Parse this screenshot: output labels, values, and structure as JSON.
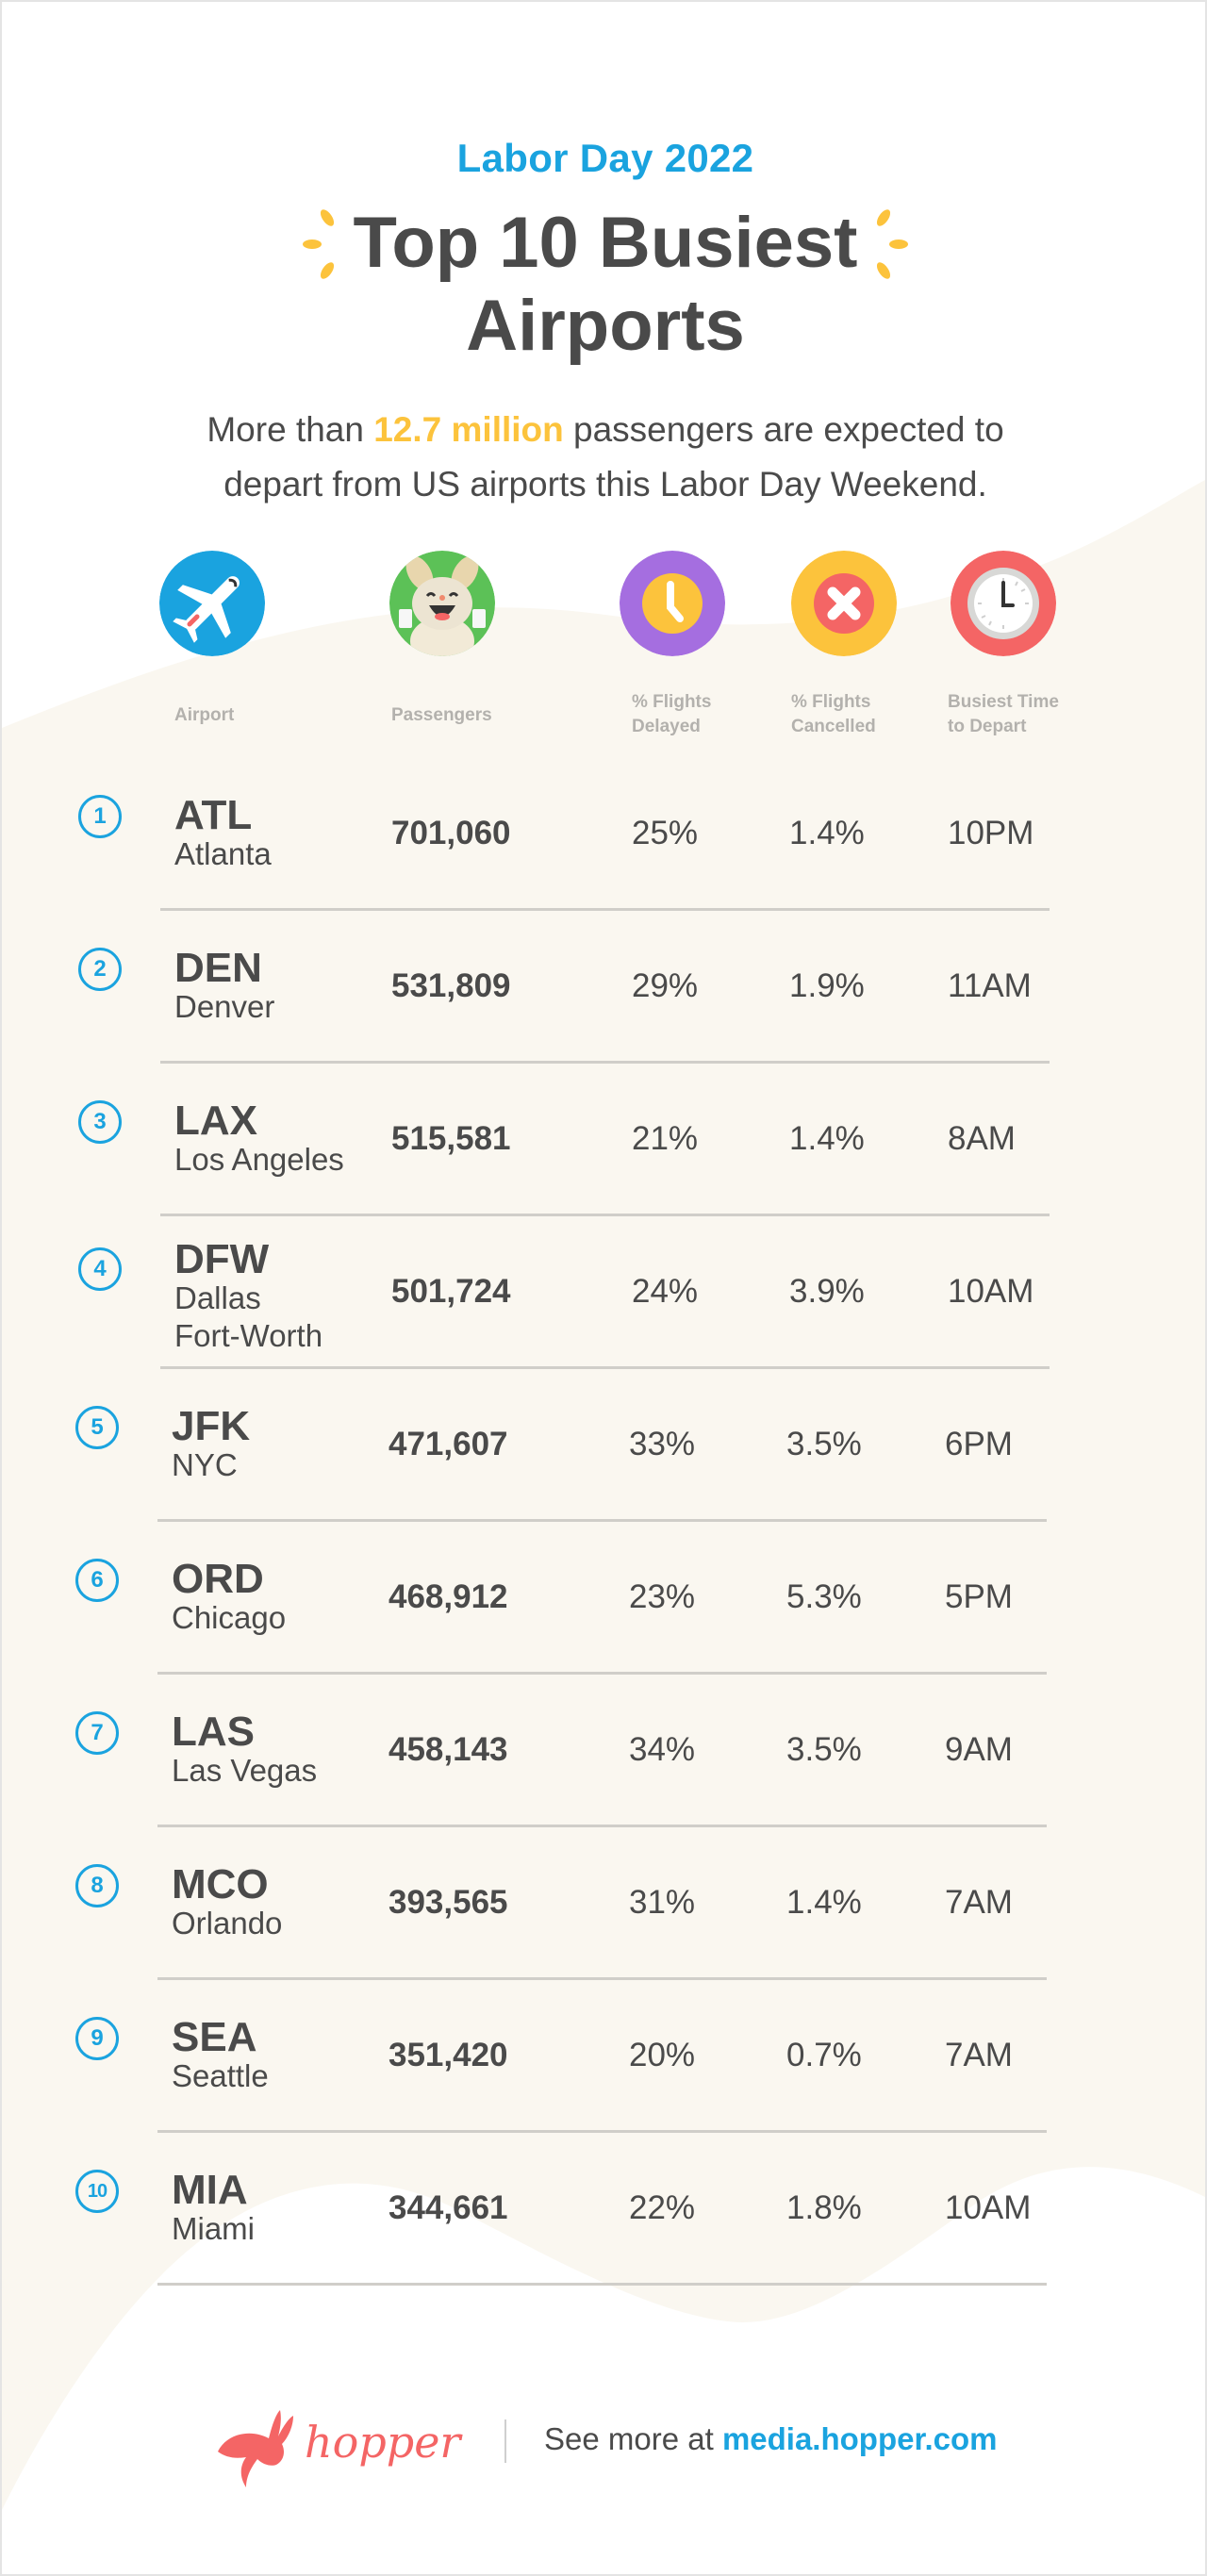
{
  "header": {
    "subtitle": "Labor Day 2022",
    "title_line1": "Top 10 Busiest",
    "title_line2": "Airports",
    "intro_prefix": "More than ",
    "intro_highlight": "12.7 million",
    "intro_suffix_line1": " passengers are expected to",
    "intro_line2": "depart from US airports this Labor Day Weekend."
  },
  "columns": [
    {
      "key": "airport",
      "label_line1": "Airport",
      "label_line2": "",
      "icon": "airplane-icon",
      "color": "#1aa3df"
    },
    {
      "key": "passengers",
      "label_line1": "Passengers",
      "label_line2": "",
      "icon": "bunny-mascot-icon",
      "color": "#5cc157"
    },
    {
      "key": "delayed",
      "label_line1": "% Flights",
      "label_line2": "Delayed",
      "icon": "delay-clock-icon",
      "color": "#a56ee0"
    },
    {
      "key": "cancelled",
      "label_line1": "% Flights",
      "label_line2": "Cancelled",
      "icon": "cancel-x-icon",
      "color": "#fcc33c"
    },
    {
      "key": "busiest_time",
      "label_line1": "Busiest Time",
      "label_line2": "to Depart",
      "icon": "clock-icon",
      "color": "#f46565"
    }
  ],
  "rows": [
    {
      "rank": "1",
      "code": "ATL",
      "city": "Atlanta",
      "city2": "",
      "passengers": "701,060",
      "delayed": "25%",
      "cancelled": "1.4%",
      "busiest_time": "10PM"
    },
    {
      "rank": "2",
      "code": "DEN",
      "city": "Denver",
      "city2": "",
      "passengers": "531,809",
      "delayed": "29%",
      "cancelled": "1.9%",
      "busiest_time": "11AM"
    },
    {
      "rank": "3",
      "code": "LAX",
      "city": "Los Angeles",
      "city2": "",
      "passengers": "515,581",
      "delayed": "21%",
      "cancelled": "1.4%",
      "busiest_time": "8AM"
    },
    {
      "rank": "4",
      "code": "DFW",
      "city": "Dallas",
      "city2": "Fort-Worth",
      "passengers": "501,724",
      "delayed": "24%",
      "cancelled": "3.9%",
      "busiest_time": "10AM"
    },
    {
      "rank": "5",
      "code": "JFK",
      "city": "NYC",
      "city2": "",
      "passengers": "471,607",
      "delayed": "33%",
      "cancelled": "3.5%",
      "busiest_time": "6PM"
    },
    {
      "rank": "6",
      "code": "ORD",
      "city": "Chicago",
      "city2": "",
      "passengers": "468,912",
      "delayed": "23%",
      "cancelled": "5.3%",
      "busiest_time": "5PM"
    },
    {
      "rank": "7",
      "code": "LAS",
      "city": "Las Vegas",
      "city2": "",
      "passengers": "458,143",
      "delayed": "34%",
      "cancelled": "3.5%",
      "busiest_time": "9AM"
    },
    {
      "rank": "8",
      "code": "MCO",
      "city": "Orlando",
      "city2": "",
      "passengers": "393,565",
      "delayed": "31%",
      "cancelled": "1.4%",
      "busiest_time": "7AM"
    },
    {
      "rank": "9",
      "code": "SEA",
      "city": "Seattle",
      "city2": "",
      "passengers": "351,420",
      "delayed": "20%",
      "cancelled": "0.7%",
      "busiest_time": "7AM"
    },
    {
      "rank": "10",
      "code": "MIA",
      "city": "Miami",
      "city2": "",
      "passengers": "344,661",
      "delayed": "22%",
      "cancelled": "1.8%",
      "busiest_time": "10AM"
    }
  ],
  "footer": {
    "brand": "hopper",
    "see_more_prefix": "See more at ",
    "see_more_link": "media.hopper.com"
  },
  "colors": {
    "accent_blue": "#1aa3df",
    "highlight_yellow": "#fcc33c",
    "brand_coral": "#f46565",
    "text_dark": "#4a4a4a",
    "label_grey": "#b3b1ad",
    "cream_bg": "#faf7f0"
  }
}
